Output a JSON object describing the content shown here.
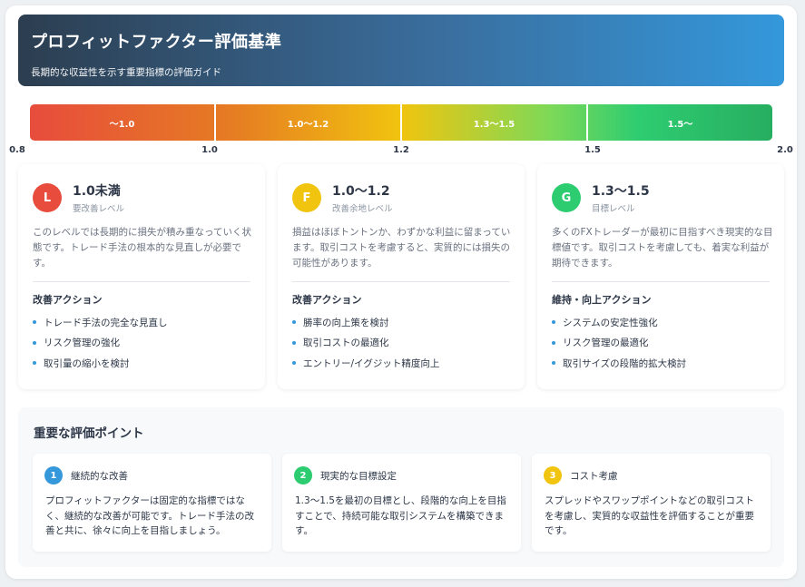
{
  "header": {
    "title": "プロフィットファクター評価基準",
    "subtitle": "長期的な収益性を示す重要指標の評価ガイド"
  },
  "scale": {
    "segments": [
      {
        "label": "〜1.0",
        "color": "#e74c3c"
      },
      {
        "label": "1.0〜1.2",
        "color": "#f1c40f"
      },
      {
        "label": "1.3〜1.5",
        "color": "#7ed957"
      },
      {
        "label": "1.5〜",
        "color": "#27ae60"
      }
    ],
    "ticks": [
      "0.8",
      "1.0",
      "1.2",
      "1.5",
      "2.0"
    ]
  },
  "cards": [
    {
      "badge": "L",
      "badge_color": "#e74c3c",
      "level": "1.0未満",
      "level_sub": "要改善レベル",
      "desc": "このレベルでは長期的に損失が積み重なっていく状態です。トレード手法の根本的な見直しが必要です。",
      "action_title": "改善アクション",
      "actions": [
        "トレード手法の完全な見直し",
        "リスク管理の強化",
        "取引量の縮小を検討"
      ]
    },
    {
      "badge": "F",
      "badge_color": "#f1c40f",
      "level": "1.0〜1.2",
      "level_sub": "改善余地レベル",
      "desc": "損益はほぼトントンか、わずかな利益に留まっています。取引コストを考慮すると、実質的には損失の可能性があります。",
      "action_title": "改善アクション",
      "actions": [
        "勝率の向上策を検討",
        "取引コストの最適化",
        "エントリー/イグジット精度向上"
      ]
    },
    {
      "badge": "G",
      "badge_color": "#2ecc71",
      "level": "1.3〜1.5",
      "level_sub": "目標レベル",
      "desc": "多くのFXトレーダーが最初に目指すべき現実的な目標値です。取引コストを考慮しても、着実な利益が期待できます。",
      "action_title": "維持・向上アクション",
      "actions": [
        "システムの安定性強化",
        "リスク管理の最適化",
        "取引サイズの段階的拡大検討"
      ]
    }
  ],
  "points": {
    "title": "重要な評価ポイント",
    "items": [
      {
        "num": "1",
        "color": "#3498db",
        "head": "継続的な改善",
        "body": "プロフィットファクターは固定的な指標ではなく、継続的な改善が可能です。トレード手法の改善と共に、徐々に向上を目指しましょう。"
      },
      {
        "num": "2",
        "color": "#2ecc71",
        "head": "現実的な目標設定",
        "body": "1.3〜1.5を最初の目標とし、段階的な向上を目指すことで、持続可能な取引システムを構築できます。"
      },
      {
        "num": "3",
        "color": "#f1c40f",
        "head": "コスト考慮",
        "body": "スプレッドやスワップポイントなどの取引コストを考慮し、実質的な収益性を評価することが重要です。"
      }
    ]
  }
}
